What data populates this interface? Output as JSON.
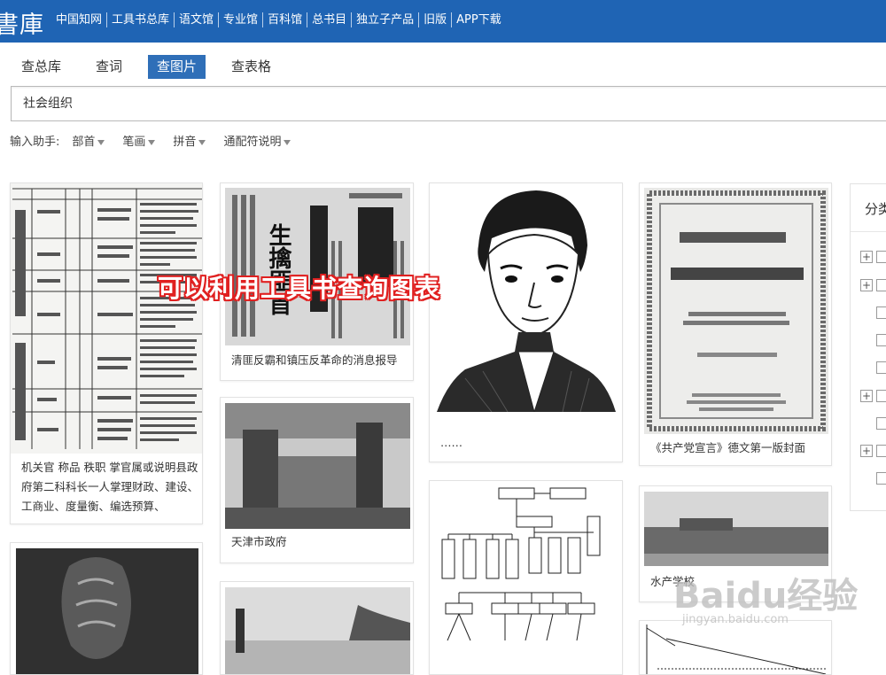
{
  "header": {
    "brand": "書庫",
    "nav": [
      "中国知网",
      "工具书总库",
      "语文馆",
      "专业馆",
      "百科馆",
      "总书目",
      "独立子产品",
      "旧版",
      "APP下载"
    ]
  },
  "tabs": [
    "查总库",
    "查词",
    "查图片",
    "查表格"
  ],
  "active_tab": "查图片",
  "search": {
    "value": "社会组织"
  },
  "assist": {
    "label": "输入助手:",
    "options": [
      "部首",
      "笔画",
      "拼音",
      "通配符说明"
    ]
  },
  "cards": {
    "table_scan": {
      "caption": "机关官 称品 秩职 掌官属或说明县政府第二科科长一人掌理财政、建设、工商业、度量衡、编选预算、"
    },
    "newspaper": {
      "caption": "清匪反霸和镇压反革命的消息报导",
      "headline": "生擒匪首"
    },
    "portrait": {
      "caption": "……"
    },
    "manifesto": {
      "caption": "《共产党宣言》德文第一版封面"
    },
    "tianjin": {
      "caption": "天津市政府"
    },
    "aquatic": {
      "caption": "水产学校"
    }
  },
  "overlay_text": "可以利用工具书查询图表",
  "sidebar": {
    "title": "分类"
  },
  "watermark": {
    "logo": "Baidu经验",
    "url": "jingyan.baidu.com"
  },
  "colors": {
    "topbar": "#1f64b4",
    "active_tab": "#2f6fb8",
    "overlay_stroke": "#e02020"
  }
}
